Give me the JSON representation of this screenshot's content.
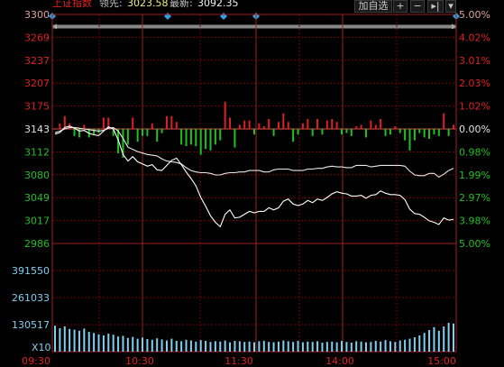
{
  "header": {
    "title": "上证指数",
    "lead_label": "领先:",
    "lead_value": "3023.58",
    "latest_label": "最新:",
    "latest_value": "3092.35",
    "add_self_label": "加自选",
    "plus_glyph": "+",
    "minus_glyph": "−",
    "arrow_glyph": "▸|",
    "menu_glyph": "▾"
  },
  "colors": {
    "background": "#000000",
    "grid": "#7a0000",
    "up": "#e02020",
    "down": "#20c020",
    "price_line": "#ffffff",
    "avg_line": "#f0f080",
    "volume": "#7fd0f0",
    "marker": "#30a0e0"
  },
  "chart_data": [
    {
      "type": "line",
      "title": "上证指数",
      "x_ticks": [
        "09:30",
        "10:30",
        "11:30",
        "14:00",
        "15:00"
      ],
      "y_ticks_left": [
        "3300",
        "3269",
        "3237",
        "3207",
        "3175",
        "3143",
        "3112",
        "3080",
        "3049",
        "3017",
        "2986"
      ],
      "y_ticks_right": [
        "5.00%",
        "4.02%",
        "3.01%",
        "2.03%",
        "1.02%",
        "0.00%",
        "0.98%",
        "1.99%",
        "2.97%",
        "3.98%",
        "5.00%"
      ],
      "ylim": [
        2986,
        3300
      ],
      "prev_close": 3143,
      "series": [
        {
          "values": [
            3136,
            3138,
            3145,
            3147,
            3144,
            3140,
            3141,
            3137,
            3135,
            3134,
            3140,
            3146,
            3143,
            3128,
            3108,
            3099,
            3105,
            3098,
            3095,
            3092,
            3094,
            3087,
            3086,
            3093,
            3100,
            3103,
            3094,
            3084,
            3075,
            3065,
            3049,
            3037,
            3024,
            3015,
            3009,
            3026,
            3032,
            3021,
            3022,
            3026,
            3030,
            3028,
            3030,
            3030,
            3035,
            3032,
            3035,
            3044,
            3047,
            3040,
            3038,
            3040,
            3045,
            3042,
            3047,
            3045,
            3049,
            3054,
            3057,
            3055,
            3054,
            3051,
            3051,
            3052,
            3048,
            3052,
            3053,
            3058,
            3055,
            3053,
            3053,
            3052,
            3046,
            3033,
            3027,
            3026,
            3022,
            3017,
            3015,
            3012,
            3021,
            3018,
            3019
          ]
        },
        {
          "values": [
            3138,
            3140,
            3143,
            3145,
            3145,
            3144,
            3143,
            3142,
            3141,
            3140,
            3141,
            3144,
            3145,
            3140,
            3130,
            3118,
            3115,
            3112,
            3110,
            3108,
            3107,
            3106,
            3102,
            3099,
            3098,
            3097,
            3095,
            3090,
            3086,
            3084,
            3083,
            3083,
            3082,
            3080,
            3080,
            3082,
            3083,
            3083,
            3084,
            3084,
            3086,
            3086,
            3086,
            3084,
            3084,
            3087,
            3088,
            3088,
            3088,
            3086,
            3086,
            3086,
            3088,
            3088,
            3089,
            3089,
            3091,
            3092,
            3091,
            3091,
            3090,
            3090,
            3093,
            3093,
            3093,
            3091,
            3092,
            3093,
            3093,
            3093,
            3093,
            3093,
            3092,
            3085,
            3080,
            3079,
            3079,
            3082,
            3082,
            3077,
            3081,
            3086,
            3089
          ]
        }
      ]
    },
    {
      "type": "bar",
      "y_ticks": [
        "391550",
        "261033",
        "130517"
      ],
      "x_label": "X10",
      "values": [
        72,
        65,
        70,
        63,
        61,
        58,
        64,
        55,
        52,
        48,
        45,
        50,
        47,
        42,
        44,
        38,
        41,
        36,
        39,
        35,
        33,
        37,
        34,
        31,
        36,
        30,
        29,
        33,
        31,
        28,
        32,
        30,
        27,
        29,
        28,
        31,
        26,
        30,
        29,
        27,
        28,
        26,
        29,
        30,
        27,
        26,
        28,
        31,
        29,
        27,
        30,
        26,
        28,
        27,
        29,
        25,
        27,
        28,
        26,
        30,
        27,
        25,
        29,
        28,
        26,
        27,
        30,
        28,
        32,
        29,
        27,
        31,
        33,
        36,
        40,
        45,
        52,
        60,
        68,
        58,
        70,
        80,
        78
      ]
    }
  ]
}
